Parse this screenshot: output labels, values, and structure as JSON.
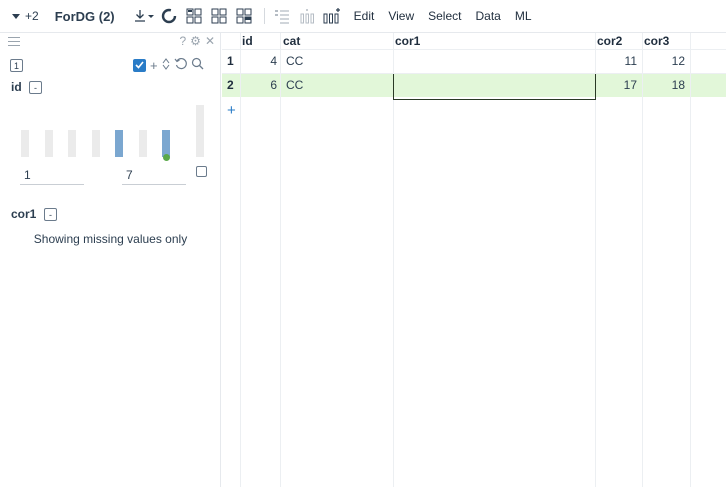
{
  "toolbar": {
    "count_label": "+2",
    "title": "ForDG (2)",
    "menus": [
      "Edit",
      "View",
      "Select",
      "Data",
      "ML"
    ]
  },
  "filter_panel": {
    "head_icons": [
      "?",
      "⚙",
      "✕"
    ],
    "badge_count": "1",
    "id_section": {
      "title": "id",
      "range_min": "1",
      "range_max": "7",
      "histogram": [
        0,
        0,
        0,
        0,
        1,
        0,
        1
      ],
      "histogram_colors": {
        "empty": "#ebebeb",
        "filled": "#7ba7d0",
        "marker": "#5aa84a"
      }
    },
    "cor1_section": {
      "title": "cor1",
      "message": "Showing missing values only"
    }
  },
  "grid": {
    "columns": [
      "id",
      "cat",
      "cor1",
      "cor2",
      "cor3"
    ],
    "rows": [
      {
        "row_num": "1",
        "id": "4",
        "cat": "CC",
        "cor1": "",
        "cor2": "11",
        "cor3": "12"
      },
      {
        "row_num": "2",
        "id": "6",
        "cat": "CC",
        "cor1": "",
        "cor2": "17",
        "cor3": "18"
      }
    ],
    "selected_row_index": 1,
    "add_row_symbol": "+",
    "selection_color": "#e2f7d9"
  }
}
